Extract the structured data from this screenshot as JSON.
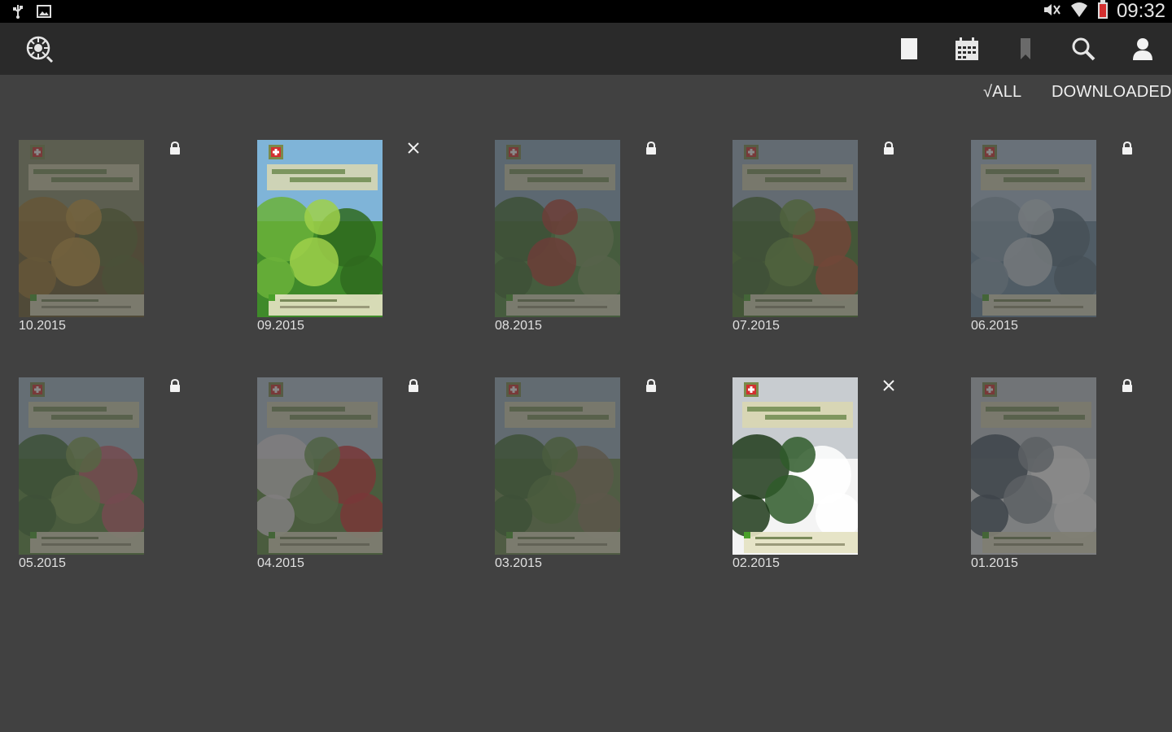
{
  "status_bar": {
    "time": "09:32",
    "left_icons": [
      "usb-icon",
      "image-icon"
    ],
    "right_icons": [
      "mute-icon",
      "wifi-icon",
      "battery-icon"
    ]
  },
  "action_bar": {
    "logo_icon": "app-logo-icon",
    "actions": [
      "single-page-icon",
      "calendar-icon",
      "bookmark-icon",
      "search-icon",
      "user-icon"
    ]
  },
  "filters": {
    "all_label": "√ALL",
    "downloaded_label": "DOWNLOADED",
    "selected": "all"
  },
  "issues": [
    {
      "date": "10.2015",
      "status": "locked",
      "status_icon": "lock-icon",
      "theme": "autumn"
    },
    {
      "date": "09.2015",
      "status": "downloaded",
      "status_icon": "close-icon",
      "theme": "vine"
    },
    {
      "date": "08.2015",
      "status": "locked",
      "status_icon": "lock-icon",
      "theme": "garden"
    },
    {
      "date": "07.2015",
      "status": "locked",
      "status_icon": "lock-icon",
      "theme": "forest"
    },
    {
      "date": "06.2015",
      "status": "locked",
      "status_icon": "lock-icon",
      "theme": "bridge"
    },
    {
      "date": "05.2015",
      "status": "locked",
      "status_icon": "lock-icon",
      "theme": "flowers"
    },
    {
      "date": "04.2015",
      "status": "locked",
      "status_icon": "lock-icon",
      "theme": "blossom"
    },
    {
      "date": "03.2015",
      "status": "locked",
      "status_icon": "lock-icon",
      "theme": "beds"
    },
    {
      "date": "02.2015",
      "status": "downloaded",
      "status_icon": "close-icon",
      "theme": "snow"
    },
    {
      "date": "01.2015",
      "status": "locked",
      "status_icon": "lock-icon",
      "theme": "arch"
    }
  ],
  "colors": {
    "background": "#414141",
    "action_bar": "#2a2a2a",
    "status_bar": "#000000",
    "swiss_red": "#d32f2f",
    "banner": "#d9d7b0"
  }
}
